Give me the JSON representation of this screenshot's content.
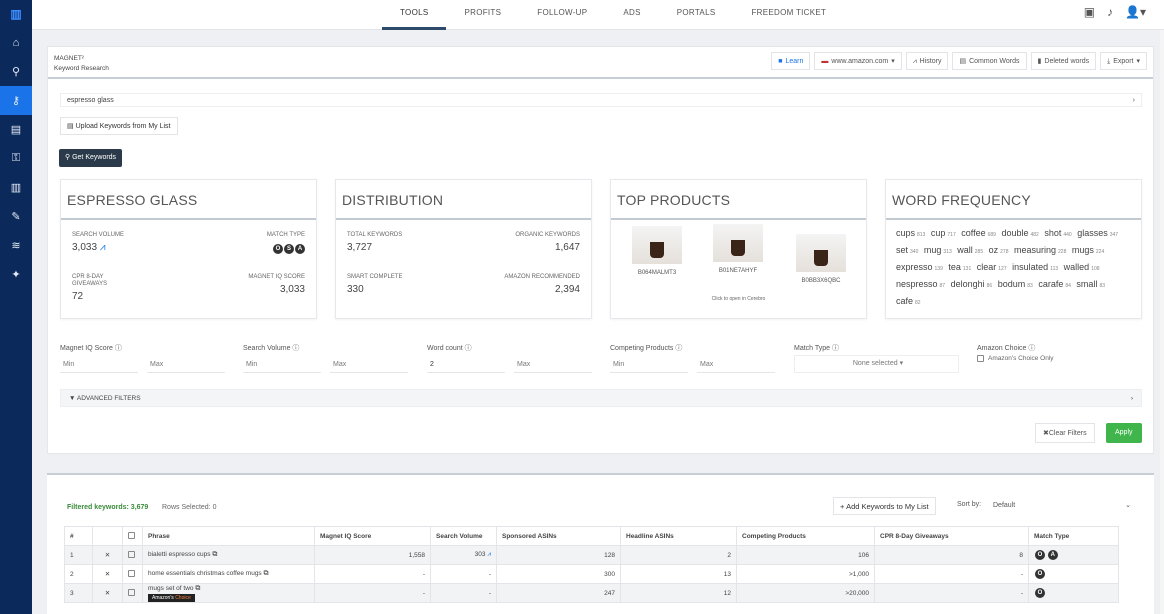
{
  "sidebar": {
    "items": [
      {
        "icon": "home-icon",
        "glyph": "⌂"
      },
      {
        "icon": "search-icon",
        "glyph": "⚲"
      },
      {
        "icon": "keyword-research-icon",
        "glyph": "⚷",
        "active": true
      },
      {
        "icon": "listing-icon",
        "glyph": "▤"
      },
      {
        "icon": "key-icon",
        "glyph": "⚿"
      },
      {
        "icon": "analytics-icon",
        "glyph": "▥"
      },
      {
        "icon": "tools-icon",
        "glyph": "✎"
      },
      {
        "icon": "academy-icon",
        "glyph": "≋"
      },
      {
        "icon": "pin-icon",
        "glyph": "✦"
      }
    ]
  },
  "nav": {
    "tabs": [
      "TOOLS",
      "PROFITS",
      "FOLLOW-UP",
      "ADS",
      "PORTALS",
      "FREEDOM TICKET"
    ],
    "active": "TOOLS"
  },
  "header": {
    "brand": "MAGNET²",
    "subtitle": "Keyword Research",
    "actions": {
      "learn": "Learn",
      "marketplace": "www.amazon.com",
      "history": "History",
      "common_words": "Common Words",
      "deleted_words": "Deleted words",
      "export": "Export"
    }
  },
  "search": {
    "value": "espresso glass",
    "upload_label": "Upload Keywords from My List",
    "get_keywords_label": "Get Keywords"
  },
  "cards": {
    "keyword": {
      "title": "ESPRESSO GLASS",
      "search_volume_label": "SEARCH VOLUME",
      "search_volume": "3,033",
      "match_type_label": "MATCH TYPE",
      "match_types": [
        "O",
        "S",
        "A"
      ],
      "cpr_label": "CPR 8-DAY GIVEAWAYS",
      "cpr": "72",
      "iq_label": "MAGNET IQ SCORE",
      "iq": "3,033"
    },
    "distribution": {
      "title": "DISTRIBUTION",
      "total_label": "TOTAL KEYWORDS",
      "total": "3,727",
      "organic_label": "ORGANIC KEYWORDS",
      "organic": "1,647",
      "smart_label": "SMART COMPLETE",
      "smart": "330",
      "amazon_label": "AMAZON RECOMMENDED",
      "amazon": "2,394"
    },
    "top_products": {
      "title": "TOP PRODUCTS",
      "products": [
        "B064MALMT3",
        "B01NE7AHYF",
        "B0BB3X6QBC"
      ],
      "hint": "Click to open in Cerebro"
    },
    "word_frequency": {
      "title": "WORD FREQUENCY",
      "words": [
        {
          "w": "cups",
          "c": "813"
        },
        {
          "w": "cup",
          "c": "717"
        },
        {
          "w": "coffee",
          "c": "689"
        },
        {
          "w": "double",
          "c": "482"
        },
        {
          "w": "shot",
          "c": "440"
        },
        {
          "w": "glasses",
          "c": "347"
        },
        {
          "w": "set",
          "c": "340"
        },
        {
          "w": "mug",
          "c": "313"
        },
        {
          "w": "wall",
          "c": "285"
        },
        {
          "w": "oz",
          "c": "278"
        },
        {
          "w": "measuring",
          "c": "228"
        },
        {
          "w": "mugs",
          "c": "224"
        },
        {
          "w": "expresso",
          "c": "139"
        },
        {
          "w": "tea",
          "c": "131"
        },
        {
          "w": "clear",
          "c": "127"
        },
        {
          "w": "insulated",
          "c": "113"
        },
        {
          "w": "walled",
          "c": "108"
        },
        {
          "w": "nespresso",
          "c": "87"
        },
        {
          "w": "delonghi",
          "c": "86"
        },
        {
          "w": "bodum",
          "c": "83"
        },
        {
          "w": "carafe",
          "c": "84"
        },
        {
          "w": "small",
          "c": "83"
        },
        {
          "w": "cafe",
          "c": "82"
        }
      ]
    }
  },
  "filters": {
    "iq": {
      "label": "Magnet IQ Score ⓘ",
      "min": "Min",
      "max": "Max"
    },
    "sv": {
      "label": "Search Volume ⓘ",
      "min": "Min",
      "max": "Max"
    },
    "wc": {
      "label": "Word count ⓘ",
      "min": "2",
      "max": "Max"
    },
    "cp": {
      "label": "Competing Products ⓘ",
      "min": "Min",
      "max": "Max"
    },
    "mt": {
      "label": "Match Type ⓘ",
      "value": "None selected"
    },
    "ac": {
      "label": "Amazon Choice ⓘ",
      "checkbox": "Amazon's Choice Only"
    },
    "advanced": "ADVANCED FILTERS",
    "clear": "Clear Filters",
    "apply": "Apply"
  },
  "results": {
    "filtered": "Filtered keywords: 3,679",
    "rows_selected": "Rows Selected: 0",
    "add_label": "Add Keywords to My List",
    "sort_label": "Sort by:",
    "sort_value": "Default",
    "columns": [
      "#",
      "",
      "",
      "Phrase",
      "Magnet IQ Score",
      "Search Volume",
      "Sponsored ASINs",
      "Headline ASINs",
      "Competing Products",
      "CPR 8-Day Giveaways",
      "Match Type"
    ],
    "rows": [
      {
        "n": "1",
        "phrase": "bialetti espresso cups",
        "iq": "1,558",
        "sv": "303",
        "sp": "128",
        "hl": "2",
        "cp": "106",
        "cpr": "8",
        "mt": [
          "O",
          "A"
        ],
        "badge": false
      },
      {
        "n": "2",
        "phrase": "home essentials christmas coffee mugs",
        "iq": "-",
        "sv": "-",
        "sp": "300",
        "hl": "13",
        "cp": ">1,000",
        "cpr": "-",
        "mt": [
          "O"
        ],
        "badge": false
      },
      {
        "n": "3",
        "phrase": "mugs set of two",
        "iq": "-",
        "sv": "-",
        "sp": "247",
        "hl": "12",
        "cp": ">20,000",
        "cpr": "-",
        "mt": [
          "O"
        ],
        "badge": true
      }
    ],
    "badge_text": "Amazon's",
    "badge_highlight": "Choice"
  }
}
